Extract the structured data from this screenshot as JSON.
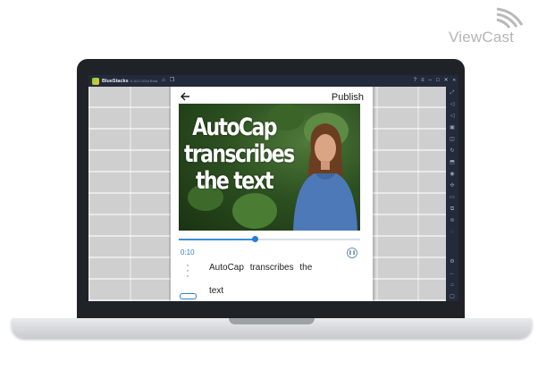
{
  "watermark": {
    "brand": "ViewCast"
  },
  "bluestacks": {
    "app_name": "BlueStacks",
    "version": "5.10.0.1034 Beta"
  },
  "app": {
    "publish_label": "Publish",
    "video_caption": "AutoCap transcribes the text",
    "player": {
      "time": "0:10",
      "progress": 0.42
    },
    "subtitle": {
      "line1": "AutoCap transcribes the",
      "line2": "text"
    }
  },
  "colors": {
    "accent": "#2f7fd6",
    "titlebar": "#232a3b",
    "bezel": "#1f2226"
  }
}
